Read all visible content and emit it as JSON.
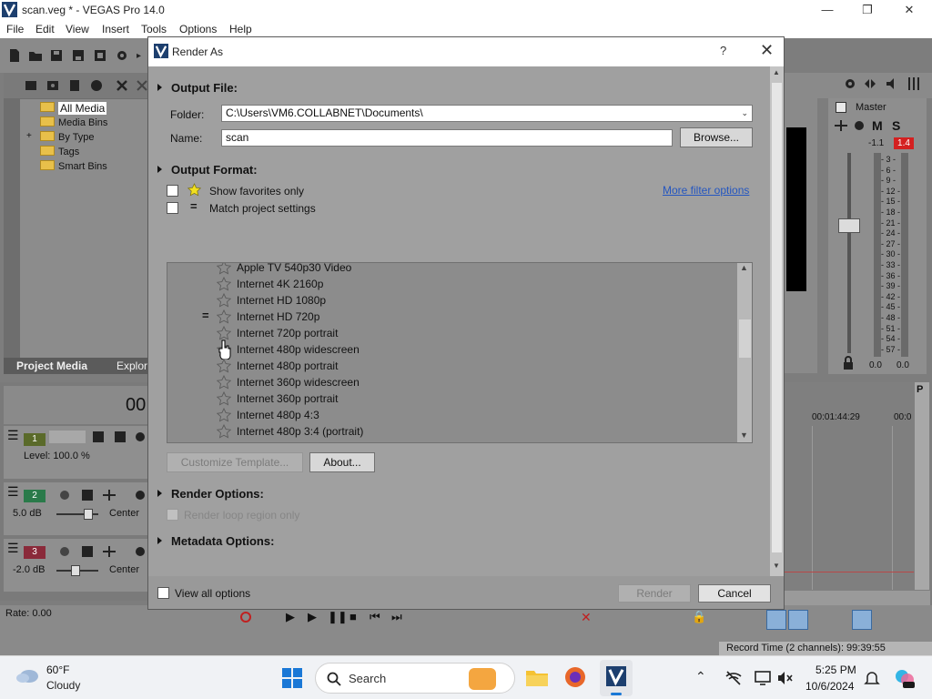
{
  "app": {
    "title": "scan.veg * - VEGAS Pro 14.0",
    "menu": [
      "File",
      "Edit",
      "View",
      "Insert",
      "Tools",
      "Options",
      "Help"
    ],
    "explorer": {
      "items": [
        "All Media",
        "Media Bins",
        "By Type",
        "Tags",
        "Smart Bins"
      ],
      "tabs": [
        "Project Media",
        "Explor"
      ]
    },
    "master": {
      "label": "Master",
      "m": "M",
      "s": "S",
      "left_peak": "-1.1",
      "right_peak": "1.4",
      "scale": [
        "3",
        "6",
        "9",
        "12",
        "15",
        "18",
        "21",
        "24",
        "27",
        "30",
        "33",
        "36",
        "39",
        "42",
        "45",
        "48",
        "51",
        "54",
        "57"
      ],
      "bottom_left": "0.0",
      "bottom_right": "0.0"
    },
    "time_display": "00",
    "tracks": [
      {
        "num": "1",
        "level": "Level: 100.0 %",
        "pan": ""
      },
      {
        "num": "2",
        "level": "5.0 dB",
        "pan": "Center"
      },
      {
        "num": "3",
        "level": "-2.0 dB",
        "pan": "Center"
      }
    ],
    "timeline": {
      "mark1": "00:01:44:29",
      "mark2": "00:0"
    },
    "rate": "Rate: 0.00",
    "record_time": "Record Time (2 channels): 99:39:55"
  },
  "dialog": {
    "title": "Render As",
    "help": "?",
    "output_file": {
      "heading": "Output File:",
      "folder_label": "Folder:",
      "folder_value": "C:\\Users\\VM6.COLLABNET\\Documents\\",
      "name_label": "Name:",
      "name_value": "scan",
      "browse": "Browse..."
    },
    "output_format": {
      "heading": "Output Format:",
      "show_favorites": "Show favorites only",
      "match_project": "Match project settings",
      "more_filter": "More filter options",
      "templates": [
        "Apple TV 540p30 Video",
        "Internet 4K 2160p",
        "Internet HD 1080p",
        "Internet HD 720p",
        "Internet 720p portrait",
        "Internet 480p widescreen",
        "Internet 480p portrait",
        "Internet 360p widescreen",
        "Internet 360p portrait",
        "Internet 480p 4:3",
        "Internet 480p 3:4 (portrait)"
      ],
      "match_marker": "=",
      "customize": "Customize Template...",
      "about": "About..."
    },
    "render_options": {
      "heading": "Render Options:",
      "loop_region": "Render loop region only"
    },
    "metadata_options": {
      "heading": "Metadata Options:"
    },
    "view_all": "View all options",
    "render": "Render",
    "cancel": "Cancel"
  },
  "taskbar": {
    "temp": "60°F",
    "condition": "Cloudy",
    "search": "Search",
    "time": "5:25 PM",
    "date": "10/6/2024"
  }
}
